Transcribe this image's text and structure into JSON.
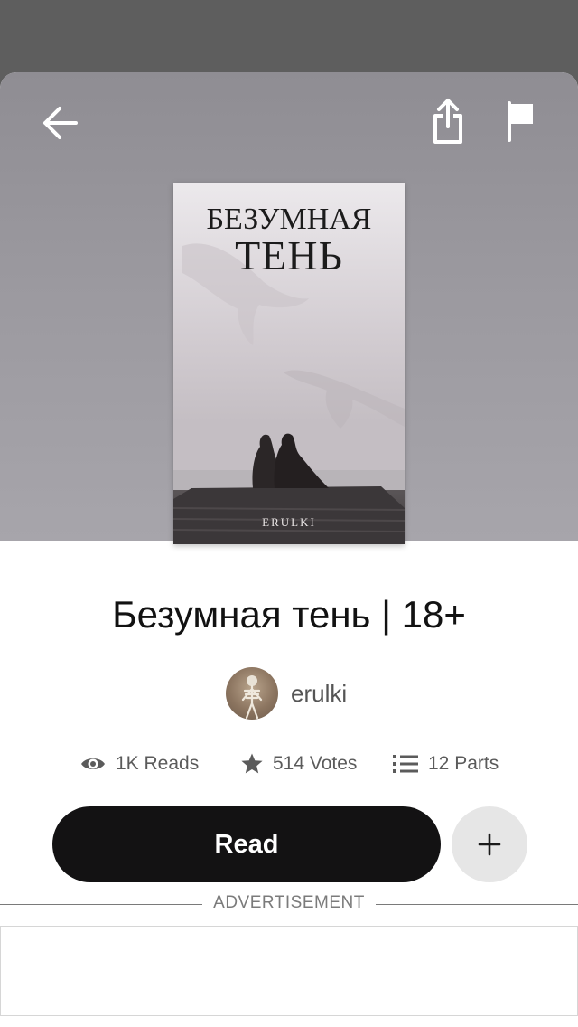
{
  "cover": {
    "title_line1": "БЕЗУМНАЯ",
    "title_line2": "ТЕНЬ",
    "author": "ERULKI"
  },
  "story": {
    "title": "Безумная тень | 18+",
    "author": "erulki"
  },
  "stats": {
    "reads": "1K Reads",
    "votes": "514 Votes",
    "parts": "12 Parts"
  },
  "actions": {
    "read_label": "Read"
  },
  "ad": {
    "label": "ADVERTISEMENT"
  },
  "icons": {
    "back": "arrow-left-icon",
    "share": "share-icon",
    "flag": "flag-icon",
    "reads": "eye-icon",
    "votes": "star-icon",
    "parts": "list-icon",
    "add": "plus-icon"
  },
  "colors": {
    "primary_button": "#131213",
    "secondary_button": "#e6e6e6",
    "header_bg": "#9b999f"
  }
}
